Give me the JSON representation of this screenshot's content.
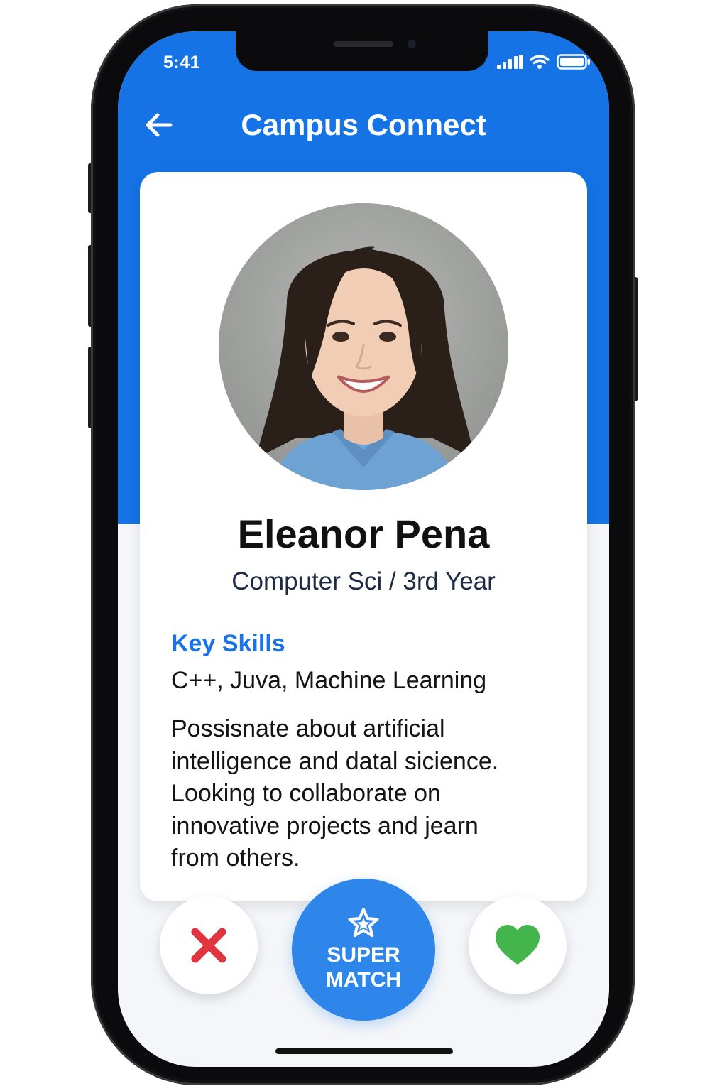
{
  "status_bar": {
    "time": "5:41",
    "icons": [
      "cellular-signal-icon",
      "wifi-icon",
      "battery-icon"
    ]
  },
  "header": {
    "title": "Campus Connect",
    "back_icon": "arrow-left-icon"
  },
  "profile": {
    "photo_icon": "profile-photo",
    "name": "Eleanor Pena",
    "major": "Computer Sci / 3rd Year",
    "skills_heading": "Key Skills",
    "skills": "C++, Juva, Machine Learning",
    "bio_lines": [
      "Possisnate about artificial",
      "intelligence and datal sicience.",
      "Looking to collaborate on",
      "innovative projects and јearn",
      "from others."
    ]
  },
  "actions": {
    "dislike_icon": "x-icon",
    "super_match_icon": "star-icon",
    "super_match_line1": "SUPER",
    "super_match_line2": "MATCH",
    "like_icon": "heart-icon"
  },
  "colors": {
    "brand_blue": "#1573e6",
    "accent_blue": "#2f86ea",
    "dislike_red": "#e0343f",
    "like_green": "#43b54c",
    "skills_heading_blue": "#1a73e8"
  }
}
